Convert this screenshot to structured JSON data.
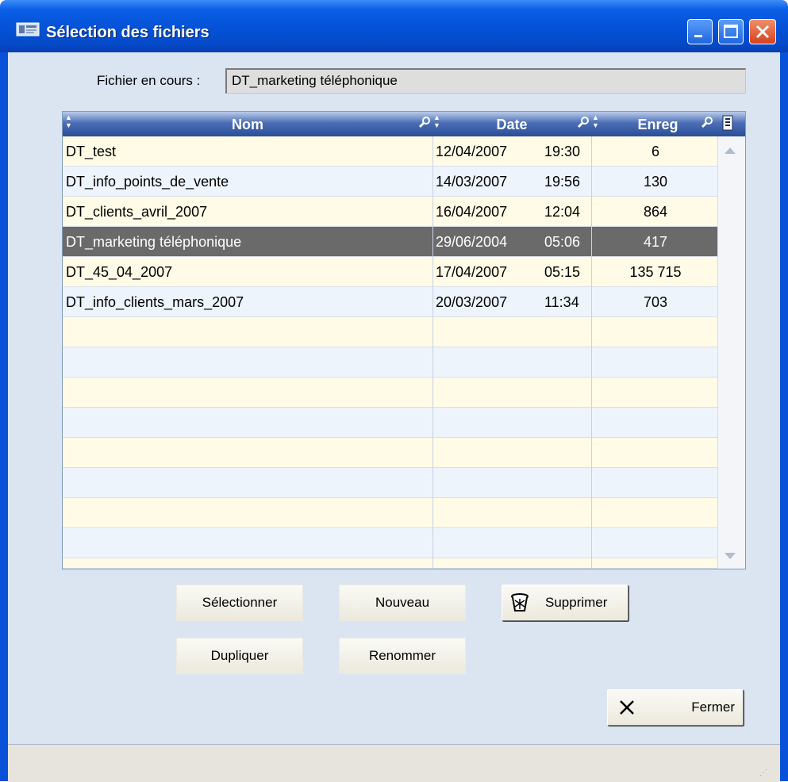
{
  "window": {
    "title": "Sélection des fichiers",
    "icons": {
      "app": "app-window-icon",
      "minimize": "minimize-icon",
      "maximize": "maximize-icon",
      "close": "close-icon"
    }
  },
  "current_file": {
    "label": "Fichier en cours :",
    "value": "DT_marketing téléphonique"
  },
  "table": {
    "columns": [
      {
        "label": "Nom"
      },
      {
        "label": "Date"
      },
      {
        "label": "Enreg"
      }
    ],
    "rows": [
      {
        "name": "DT_test",
        "date": "12/04/2007",
        "time": "19:30",
        "records": "6"
      },
      {
        "name": "DT_info_points_de_vente",
        "date": "14/03/2007",
        "time": "19:56",
        "records": "130"
      },
      {
        "name": "DT_clients_avril_2007",
        "date": "16/04/2007",
        "time": "12:04",
        "records": "864"
      },
      {
        "name": "DT_marketing téléphonique",
        "date": "29/06/2004",
        "time": "05:06",
        "records": "417"
      },
      {
        "name": "DT_45_04_2007",
        "date": "17/04/2007",
        "time": "05:15",
        "records": "135 715"
      },
      {
        "name": "DT_info_clients_mars_2007",
        "date": "20/03/2007",
        "time": "11:34",
        "records": "703"
      }
    ],
    "selected_row_index": 3,
    "colors": {
      "row_odd": "#fffbe6",
      "row_even": "#eef4fb",
      "row_selected": "#6a6a6a",
      "header": "#2a4d98"
    }
  },
  "buttons": {
    "select": "Sélectionner",
    "new": "Nouveau",
    "delete": "Supprimer",
    "duplicate": "Dupliquer",
    "rename": "Renommer",
    "close": "Fermer"
  }
}
